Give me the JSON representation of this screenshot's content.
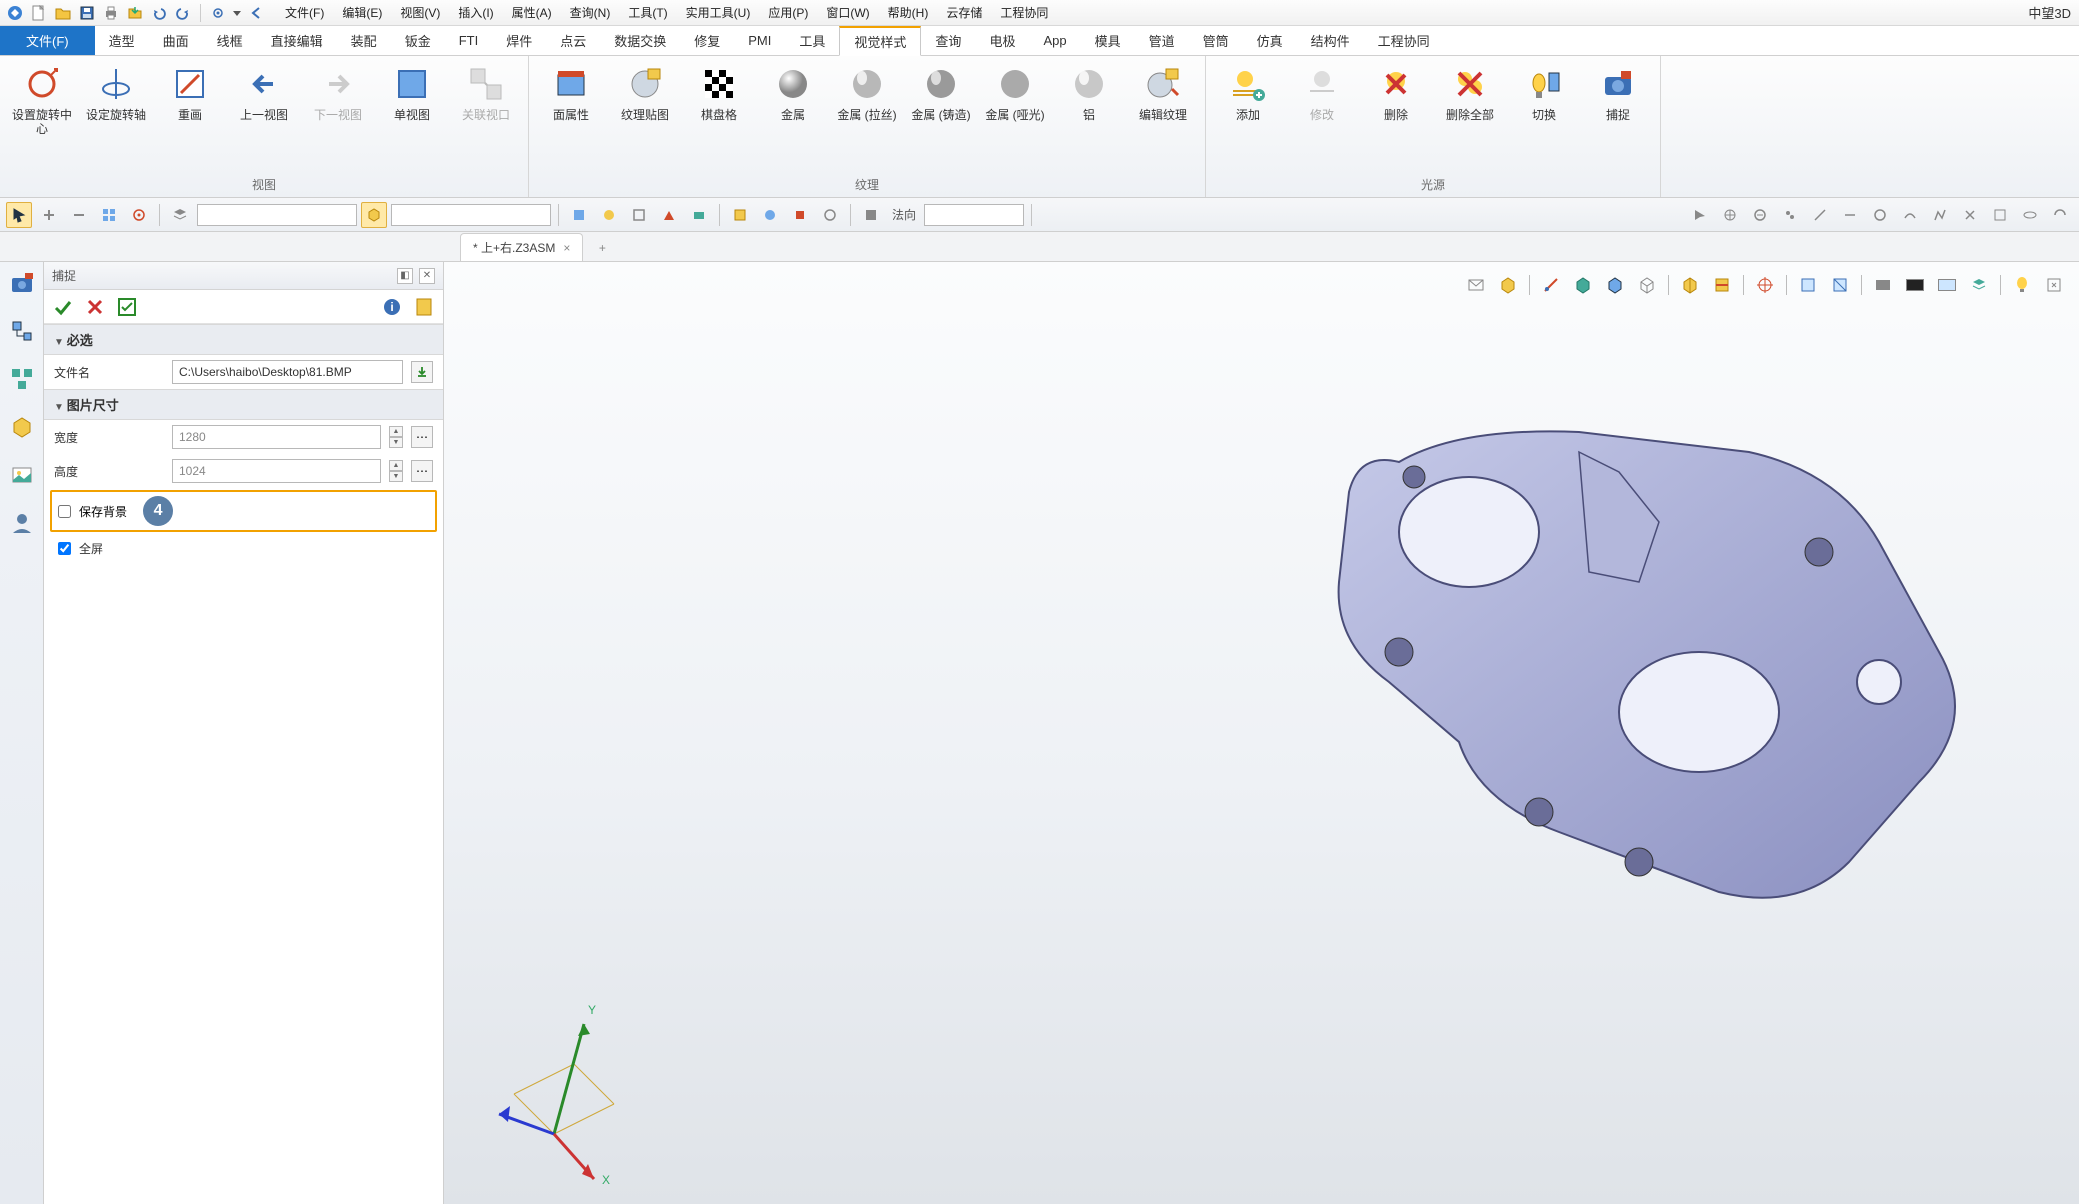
{
  "app": {
    "brand": "中望3D"
  },
  "menubar": [
    "文件(F)",
    "编辑(E)",
    "视图(V)",
    "插入(I)",
    "属性(A)",
    "查询(N)",
    "工具(T)",
    "实用工具(U)",
    "应用(P)",
    "窗口(W)",
    "帮助(H)",
    "云存储",
    "工程协同"
  ],
  "ribbon": {
    "file_tab": "文件(F)",
    "tabs": [
      "造型",
      "曲面",
      "线框",
      "直接编辑",
      "装配",
      "钣金",
      "FTI",
      "焊件",
      "点云",
      "数据交换",
      "修复",
      "PMI",
      "工具",
      "视觉样式",
      "查询",
      "电极",
      "App",
      "模具",
      "管道",
      "管筒",
      "仿真",
      "结构件",
      "工程协同"
    ],
    "active": "视觉样式",
    "group_view": {
      "label": "视图",
      "items": [
        "设置旋转中心",
        "设定旋转轴",
        "重画",
        "上一视图",
        "下一视图",
        "单视图",
        "关联视口"
      ]
    },
    "group_texture": {
      "label": "纹理",
      "items": [
        "面属性",
        "纹理贴图",
        "棋盘格",
        "金属",
        "金属 (拉丝)",
        "金属 (铸造)",
        "金属 (哑光)",
        "铝",
        "编辑纹理"
      ]
    },
    "group_light": {
      "label": "光源",
      "items": [
        "添加",
        "修改",
        "删除",
        "删除全部",
        "切换",
        "捕捉"
      ]
    }
  },
  "toolbar2": {
    "normal_label": "法向"
  },
  "doc_tab": {
    "name": "* 上+右.Z3ASM",
    "close": "×",
    "plus": "+"
  },
  "panel": {
    "title": "捕捉",
    "sec_required": "必选",
    "filename_label": "文件名",
    "filename_value": "C:\\Users\\haibo\\Desktop\\81.BMP",
    "sec_size": "图片尺寸",
    "width_label": "宽度",
    "width_value": "1280",
    "height_label": "高度",
    "height_value": "1024",
    "save_bg": "保存背景",
    "fullscreen": "全屏",
    "badge": "4"
  },
  "triad": {
    "x": "X",
    "y": "Y"
  }
}
